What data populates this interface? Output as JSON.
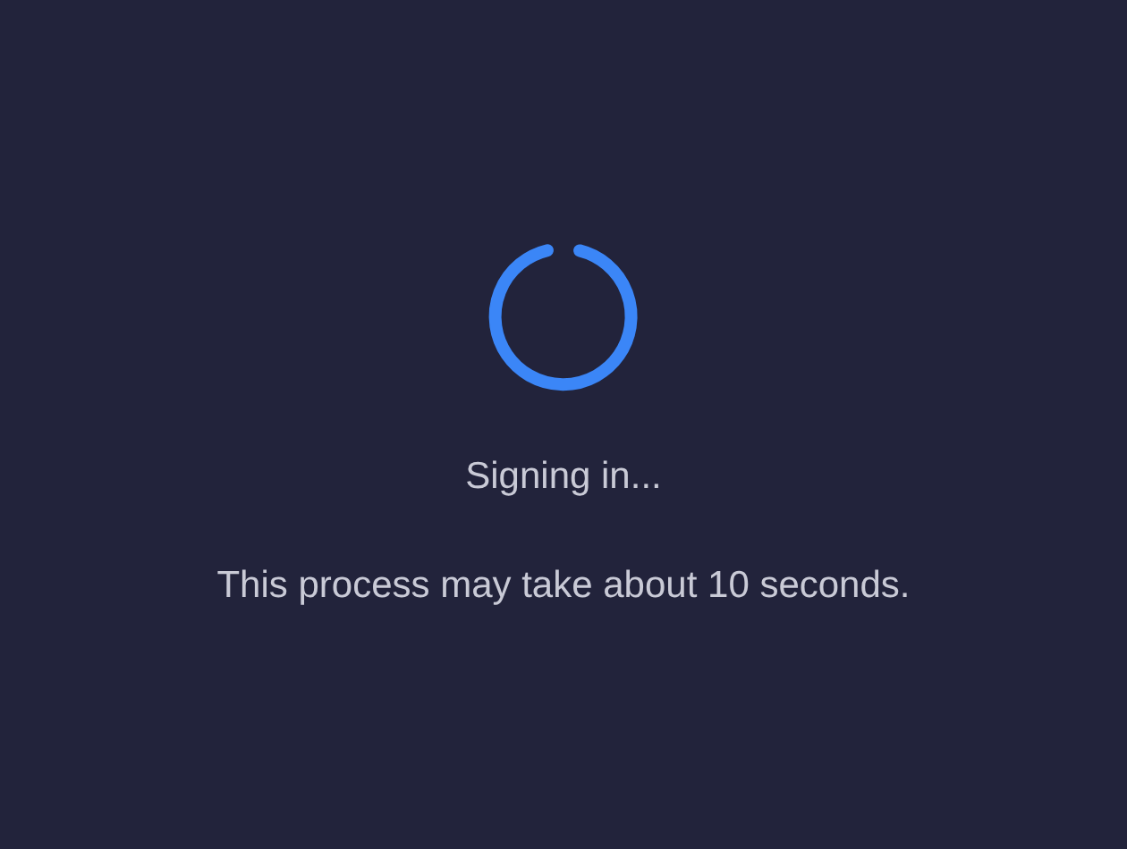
{
  "status": {
    "title": "Signing in...",
    "message": "This process may take about 10 seconds."
  }
}
